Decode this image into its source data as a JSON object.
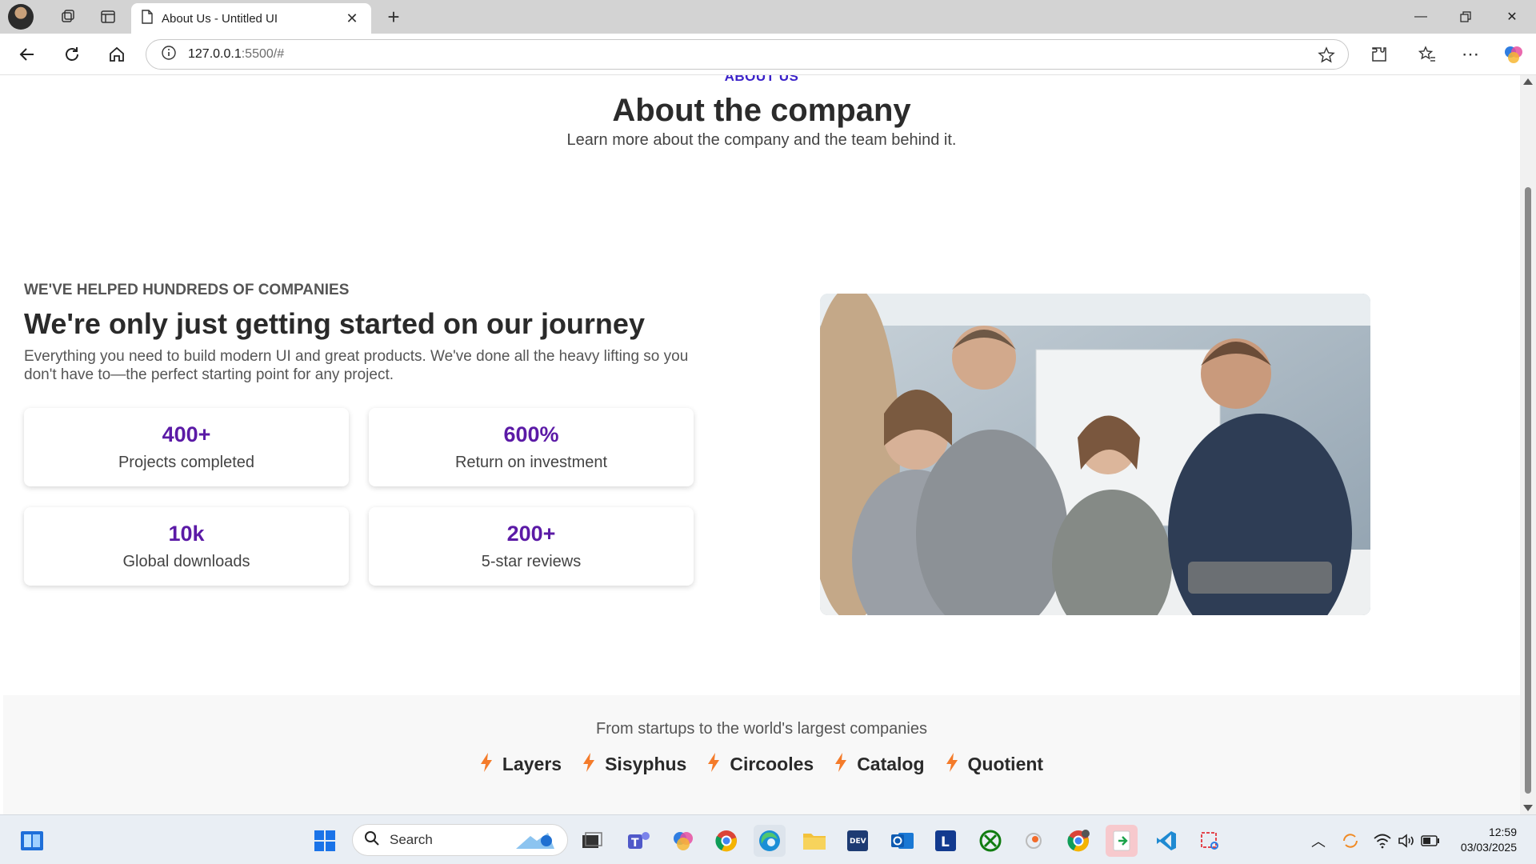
{
  "browser": {
    "tab_title": "About Us - Untitled UI",
    "new_tab": "+",
    "address_host": "127.0.0.1",
    "address_path": ":5500/#"
  },
  "page": {
    "eyebrow": "ABOUT US",
    "title": "About the company",
    "subtitle": "Learn more about the company and the team behind it.",
    "section": {
      "kicker": "WE'VE HELPED HUNDREDS OF COMPANIES",
      "title": "We're only just getting started on our journey",
      "text": "Everything you need to build modern UI and great products. We've done all the heavy lifting so you don't have to—the perfect starting point for any project."
    },
    "stats": [
      {
        "value": "400+",
        "label": "Projects completed"
      },
      {
        "value": "600%",
        "label": "Return on investment"
      },
      {
        "value": "10k",
        "label": "Global downloads"
      },
      {
        "value": "200+",
        "label": "5-star reviews"
      }
    ],
    "logos": {
      "caption": "From startups to the world's largest companies",
      "items": [
        "Layers",
        "Sisyphus",
        "Circooles",
        "Catalog",
        "Quotient"
      ]
    }
  },
  "taskbar": {
    "search_label": "Search",
    "time": "12:59",
    "date": "03/03/2025"
  },
  "colors": {
    "accent": "#3b22c9",
    "stat_value": "#5b1aa6",
    "logo_icon": "#f47b2a"
  },
  "icons": {
    "tab": "page-icon",
    "security": "info-icon",
    "favorite": "star-icon"
  }
}
